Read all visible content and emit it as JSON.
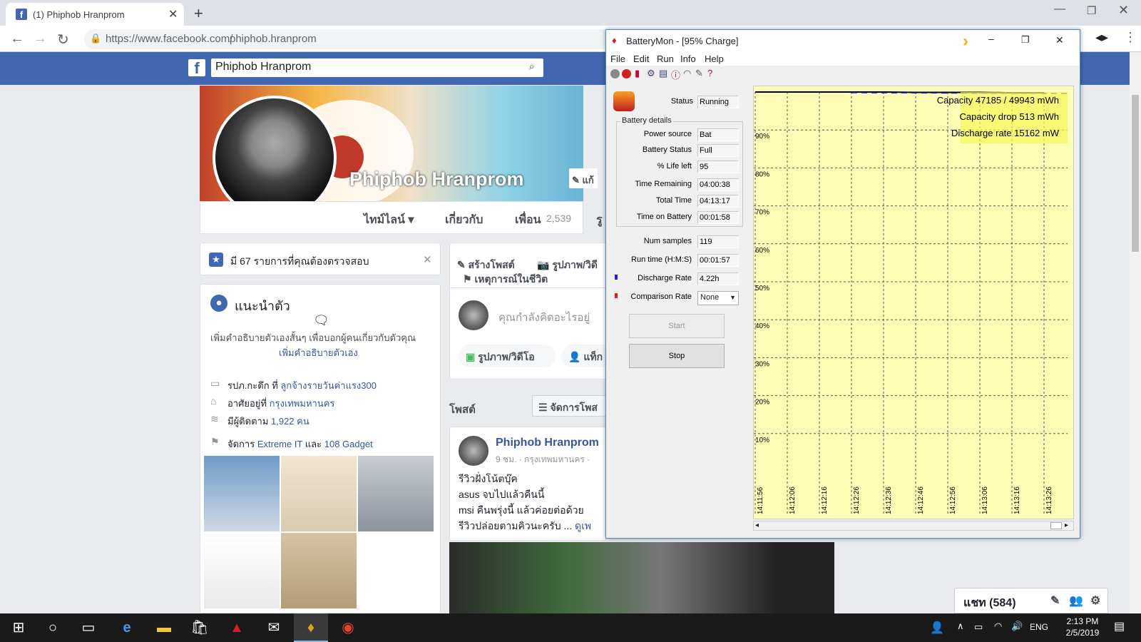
{
  "browser": {
    "tab_title": "(1) Phiphob Hranprom",
    "url_host": "https://www.facebook.com/",
    "url_path": "phiphob.hranprom"
  },
  "facebook": {
    "search_value": "Phiphob Hranprom",
    "profile_name": "Phiphob Hranprom",
    "cover_edit_label": "แก้",
    "nav": [
      "ไทม์ไลน์ ▾",
      "เกี่ยวกับ",
      "เพื่อน",
      "2,539",
      "รู"
    ],
    "review_banner": "มี 67 รายการที่คุณต้องตรวจสอบ",
    "intro_title": "แนะนำตัว",
    "intro_desc": "เพิ่มคำอธิบายตัวเองสั้นๆ เพื่อบอกผู้คนเกี่ยวกับตัวคุณ",
    "intro_link": "เพิ่มคำอธิบายตัวเอง",
    "details": [
      {
        "prefix": "รปภ.กะดึก ที่ ",
        "link": "ลูกจ้างรายวันค่าแรง300",
        "suffix": ""
      },
      {
        "prefix": "อาศัยอยู่ที่ ",
        "link": "กรุงเทพมหานคร",
        "suffix": ""
      },
      {
        "prefix": "มีผู้ติดตาม ",
        "link": "1,922 คน",
        "suffix": ""
      },
      {
        "prefix": "จัดการ ",
        "link": "Extreme IT",
        "suffix": " และ ",
        "link2": "108 Gadget"
      }
    ],
    "composer_tabs": [
      "สร้างโพสต์",
      "รูปภาพ/วิดี",
      "เหตุการณ์ในชีวิต"
    ],
    "composer_placeholder": "คุณกำลังคิดอะไรอยู่",
    "composer_buttons": [
      "รูปภาพ/วิดีโอ",
      "แท็ก"
    ],
    "posts_header": "โพสต์",
    "manage_posts": "จัดการโพส",
    "post": {
      "author": "Phiphob Hranprom",
      "meta": "9 ชม. · กรุงเทพมหานคร ·",
      "lines": [
        "รีวิวฝั่งโน้ตบุ๊ค",
        "asus จบไปแล้วคืนนี้",
        "msi คืนพรุ่งนี้ แล้วค่อยต่อด้วย",
        "รีวิวปล่อยตามคิวนะครับ ... "
      ],
      "see_more": "ดูเพ"
    },
    "chat_label": "แชท (584)"
  },
  "batterymon": {
    "title": "BatteryMon - [95% Charge]",
    "menu": [
      "File",
      "Edit",
      "Run",
      "Info",
      "Help"
    ],
    "status_label": "Status",
    "status_value": "Running",
    "group_label": "Battery details",
    "details": [
      {
        "label": "Power source",
        "value": "Bat"
      },
      {
        "label": "Battery Status",
        "value": "Full"
      },
      {
        "label": "% Life left",
        "value": "95"
      },
      {
        "label": "Time Remaining",
        "value": "04:00:38"
      },
      {
        "label": "Total Time",
        "value": "04:13:17"
      },
      {
        "label": "Time on Battery",
        "value": "00:01:58"
      }
    ],
    "num_samples_label": "Num samples",
    "num_samples": "119",
    "run_time_label": "Run time (H:M:S)",
    "run_time": "00:01:57",
    "discharge_label": "Discharge Rate",
    "discharge_value": "4.22h",
    "comparison_label": "Comparison Rate",
    "comparison_value": "None",
    "start_label": "Start",
    "stop_label": "Stop",
    "colors": {
      "chart_bg": "#fdfdb6",
      "discharge_marker": "#1f1fdf",
      "comparison_marker": "#e01f1f"
    }
  },
  "chart_data": {
    "type": "line",
    "annotations": [
      "Capacity 47185 / 49943 mWh",
      "Capacity drop 513 mWh",
      "Discharge rate 15162 mW"
    ],
    "y_ticks": [
      "90%",
      "80%",
      "70%",
      "60%",
      "50%",
      "40%",
      "30%",
      "20%",
      "10%"
    ],
    "x_ticks": [
      "14:11:56",
      "14:12:06",
      "14:12:16",
      "14:12:26",
      "14:12:36",
      "14:12:46",
      "14:12:56",
      "14:13:06",
      "14:13:16",
      "14:13:26"
    ],
    "ylim": [
      0,
      100
    ],
    "series": [
      {
        "values": [
          100,
          100,
          100,
          100,
          100,
          99.9,
          99.9,
          99.9,
          99.8,
          99.8
        ]
      }
    ],
    "grid": true
  },
  "taskbar": {
    "time": "2:13 PM",
    "date": "2/5/2019",
    "lang": "ENG"
  }
}
